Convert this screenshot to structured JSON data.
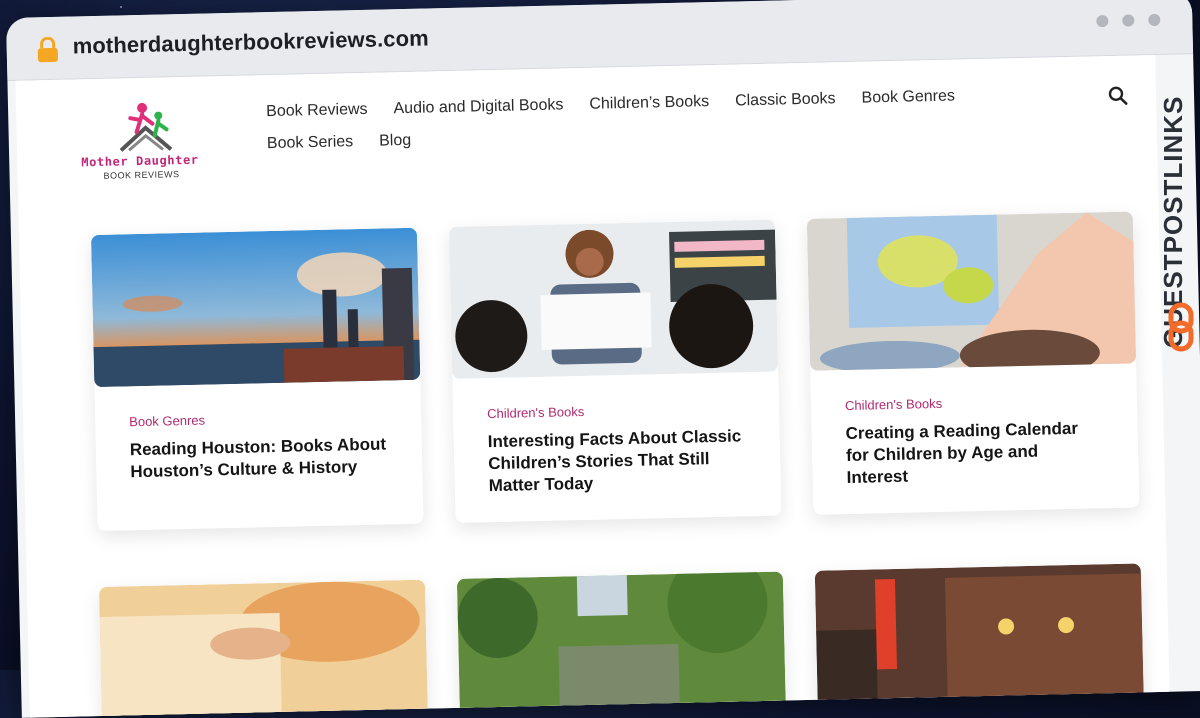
{
  "browser": {
    "url": "motherdaughterbookreviews.com"
  },
  "site": {
    "logo_title": "Mother Daughter",
    "logo_subtitle": "BOOK REVIEWS"
  },
  "nav": {
    "row1": [
      "Book Reviews",
      "Audio and Digital Books",
      "Children’s Books",
      "Classic Books",
      "Book Genres"
    ],
    "row2": [
      "Book Series",
      "Blog"
    ]
  },
  "cards": [
    {
      "category": "Book Genres",
      "title": "Reading Houston: Books About Houston’s Culture & History"
    },
    {
      "category": "Children's Books",
      "title": "Interesting Facts About Classic Children’s Stories That Still Matter Today"
    },
    {
      "category": "Children's Books",
      "title": "Creating a Reading Calendar for Children by Age and Interest"
    }
  ],
  "watermark": {
    "text": "GUESTPOSTLINKS"
  },
  "colors": {
    "accent": "#b0296f",
    "watermark_orange": "#f26b2a"
  }
}
